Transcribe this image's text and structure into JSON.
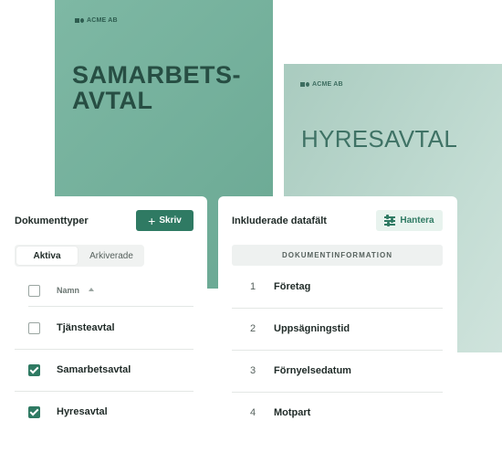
{
  "covers": [
    {
      "brand": "ACME AB",
      "title_line1": "SAMARBETS-",
      "title_line2": "AVTAL"
    },
    {
      "brand": "ACME AB",
      "title": "HYRESAVTAL"
    }
  ],
  "left_panel": {
    "title": "Dokumenttyper",
    "new_button": {
      "icon": "plus-icon",
      "label": "Skriv"
    },
    "tabs": [
      {
        "label": "Aktiva",
        "active": true
      },
      {
        "label": "Arkiverade",
        "active": false
      }
    ],
    "column_header": "Namn",
    "rows": [
      {
        "label": "Tjänsteavtal",
        "checked": false
      },
      {
        "label": "Samarbetsavtal",
        "checked": true
      },
      {
        "label": "Hyresavtal",
        "checked": true
      }
    ]
  },
  "right_panel": {
    "title": "Inkluderade datafält",
    "manage_button": {
      "icon": "sliders-icon",
      "label": "Hantera"
    },
    "section": "DOKUMENTINFORMATION",
    "fields": [
      {
        "num": "1",
        "label": "Företag"
      },
      {
        "num": "2",
        "label": "Uppsägningstid"
      },
      {
        "num": "3",
        "label": "Förnyelsedatum"
      },
      {
        "num": "4",
        "label": "Motpart"
      }
    ]
  },
  "colors": {
    "accent": "#2f7a63",
    "cover_a": "#76b29d",
    "cover_b": "#b8d5ca"
  }
}
